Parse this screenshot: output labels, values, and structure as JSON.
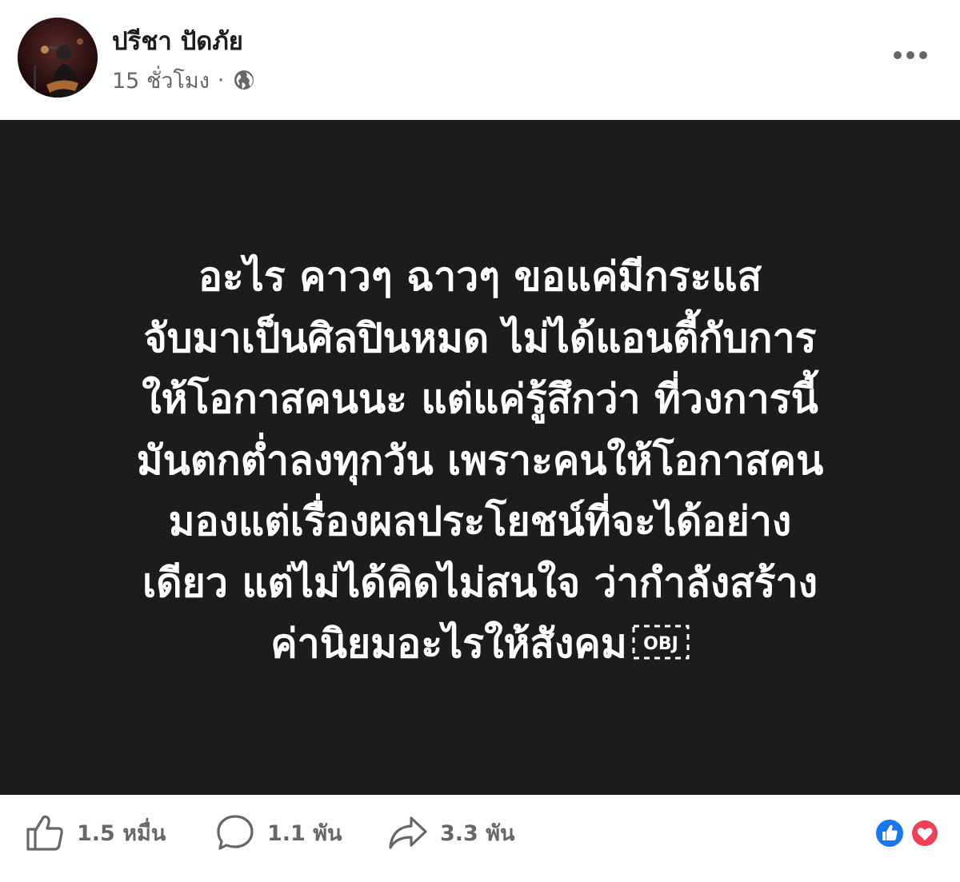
{
  "post": {
    "author": "ปรีชา ปัดภัย",
    "time": "15 ชั่วโมง",
    "separator": "·",
    "privacy_icon": "globe-icon",
    "more_icon": "more-options-icon",
    "lines": [
      "อะไร คาวๆ ฉาวๆ ขอแค่มีกระแส",
      "จับมาเป็นศิลปินหมด ไม่ได้แอนตี้กับการ",
      "ให้โอกาสคนนะ แต่แค่รู้สึกว่า ที่วงการนี้",
      "มันตกต่ำลงทุกวัน เพราะคนให้โอกาสคน",
      "มองแต่เรื่องผลประโยชน์ที่จะได้อย่าง",
      "เดียว แต่ไม่ได้คิดไม่สนใจ ว่ากำลังสร้าง",
      "ค่านิยมอะไรให้สังคม"
    ],
    "obj_glyph": "OBJ",
    "background_color": "#1c1c1c",
    "text_color": "#ffffff"
  },
  "footer": {
    "likes": "1.5 หมื่น",
    "comments": "1.1 พัน",
    "shares": "3.3 พัน",
    "reaction_icons": [
      "like-reaction-icon",
      "love-reaction-icon"
    ],
    "like_color": "#1877f2",
    "love_color": "#f33e58"
  }
}
